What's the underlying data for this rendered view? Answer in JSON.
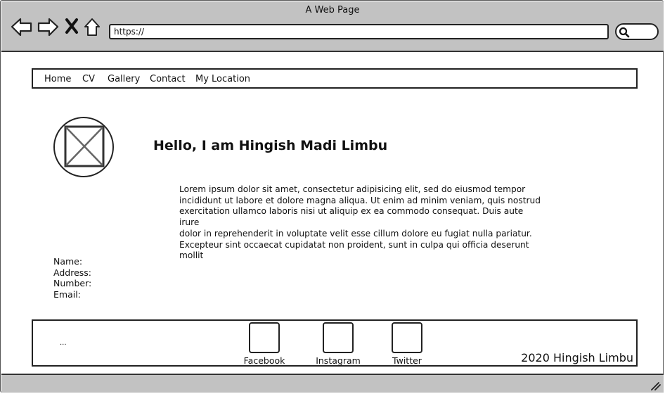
{
  "window": {
    "title": "A Web Page"
  },
  "browser": {
    "back_icon": "back-arrow-icon",
    "forward_icon": "forward-arrow-icon",
    "close_icon": "close-x-icon",
    "home_icon": "home-icon",
    "url": "https://",
    "search_icon": "search-icon"
  },
  "nav": {
    "items": [
      {
        "label": "Home"
      },
      {
        "label": "CV"
      },
      {
        "label": "Gallery"
      },
      {
        "label": "Contact"
      },
      {
        "label": "My Location"
      }
    ]
  },
  "profile": {
    "image_icon": "image-placeholder-icon",
    "heading": "Hello, I am Hingish Madi Limbu",
    "bio": "Lorem ipsum dolor sit amet, consectetur adipisicing elit, sed do eiusmod tempor\nincididunt ut labore et dolore magna aliqua. Ut enim ad minim veniam, quis nostrud\nexercitation ullamco laboris nisi ut aliquip ex ea commodo consequat. Duis aute irure\ndolor in reprehenderit in voluptate velit esse cillum dolore eu fugiat nulla pariatur.\nExcepteur sint occaecat cupidatat non proident, sunt in culpa qui officia deserunt mollit"
  },
  "contact": {
    "name_label": "Name:",
    "address_label": "Address:",
    "number_label": "Number:",
    "email_label": "Email:"
  },
  "footer": {
    "dots": "...",
    "social": [
      {
        "label": "Facebook"
      },
      {
        "label": "Instagram"
      },
      {
        "label": "Twitter"
      }
    ],
    "copyright": "2020 Hingish Limbu"
  },
  "colors": {
    "chrome": "#c2c2c2",
    "stroke": "#222222",
    "page": "#ffffff"
  }
}
